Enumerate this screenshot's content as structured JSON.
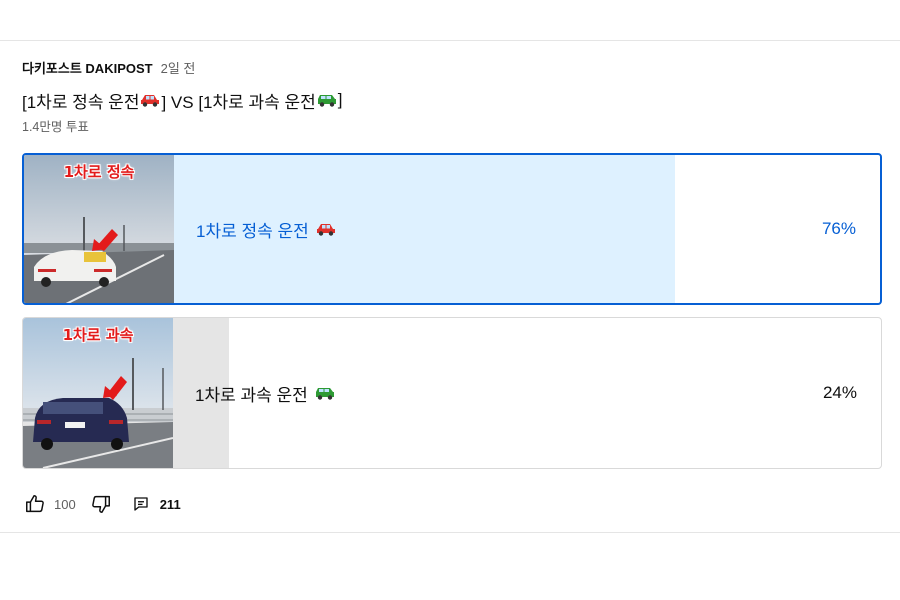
{
  "post": {
    "author": "다키포스트 DAKIPOST",
    "time": "2일 전",
    "title_parts": [
      "[1차로 정속 운전",
      "] VS [1차로 과속 운전",
      "]"
    ],
    "votes": "1.4만명 투표"
  },
  "poll": {
    "options": [
      {
        "label": "1차로 정속 운전",
        "percent": "76%",
        "percent_value": 76,
        "thumbnail_caption": "1차로 정속",
        "car_icon": "red-car-icon",
        "selected": true,
        "fill_color": "#def1ff",
        "car_color": "#e0312b"
      },
      {
        "label": "1차로 과속 운전",
        "percent": "24%",
        "percent_value": 24,
        "thumbnail_caption": "1차로 과속",
        "car_icon": "green-car-icon",
        "selected": false,
        "fill_color": "#e5e5e5",
        "car_color": "#2e9a34"
      }
    ]
  },
  "actions": {
    "like_count": "100",
    "comment_count": "211"
  },
  "colors": {
    "selected_border": "#065fd4",
    "selected_text": "#065fd4",
    "muted_text": "#606060"
  }
}
